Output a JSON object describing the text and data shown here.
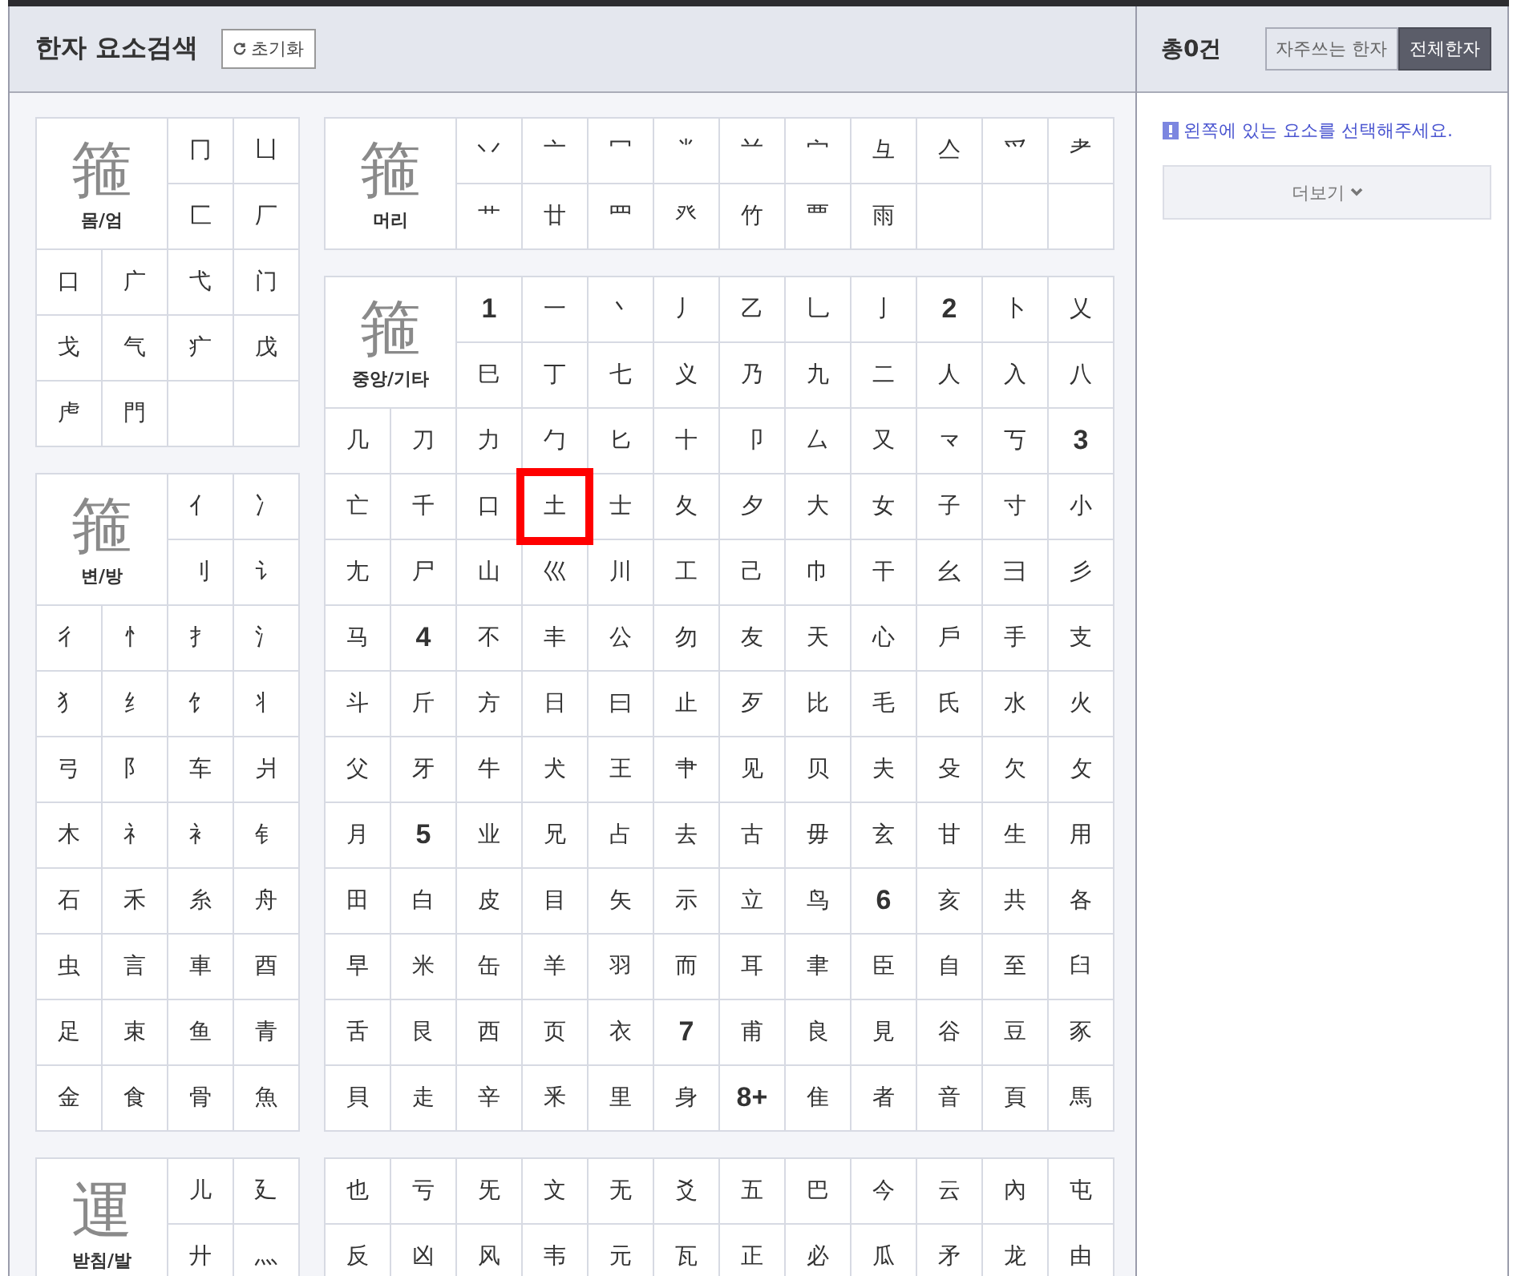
{
  "header": {
    "title": "한자 요소검색",
    "reset_button": "초기화"
  },
  "left_panels": [
    {
      "example": "箍",
      "label": "몸/엄",
      "cells": [
        {
          "text": "冂",
          "kind": "radical",
          "selected": false
        },
        {
          "text": "凵",
          "kind": "radical",
          "selected": false
        },
        {
          "text": "匚",
          "kind": "radical",
          "selected": false
        },
        {
          "text": "厂",
          "kind": "radical",
          "selected": false
        },
        {
          "text": "口",
          "kind": "radical",
          "selected": false
        },
        {
          "text": "广",
          "kind": "radical",
          "selected": false
        },
        {
          "text": "弋",
          "kind": "radical",
          "selected": false
        },
        {
          "text": "门",
          "kind": "radical",
          "selected": false
        },
        {
          "text": "戈",
          "kind": "radical",
          "selected": false
        },
        {
          "text": "气",
          "kind": "radical",
          "selected": false
        },
        {
          "text": "疒",
          "kind": "radical",
          "selected": false
        },
        {
          "text": "戊",
          "kind": "radical",
          "selected": false
        },
        {
          "text": "虍",
          "kind": "radical",
          "selected": false
        },
        {
          "text": "門",
          "kind": "radical",
          "selected": false
        }
      ]
    },
    {
      "example": "箍",
      "label": "변/방",
      "cells": [
        {
          "text": "亻",
          "kind": "radical",
          "selected": false
        },
        {
          "text": "冫",
          "kind": "radical",
          "selected": false
        },
        {
          "text": "刂",
          "kind": "radical",
          "selected": false
        },
        {
          "text": "讠",
          "kind": "radical",
          "selected": false
        },
        {
          "text": "彳",
          "kind": "radical",
          "selected": false
        },
        {
          "text": "忄",
          "kind": "radical",
          "selected": false
        },
        {
          "text": "扌",
          "kind": "radical",
          "selected": false
        },
        {
          "text": "氵",
          "kind": "radical",
          "selected": false
        },
        {
          "text": "犭",
          "kind": "radical",
          "selected": false
        },
        {
          "text": "纟",
          "kind": "radical",
          "selected": false
        },
        {
          "text": "饣",
          "kind": "radical",
          "selected": false
        },
        {
          "text": "丬",
          "kind": "radical",
          "selected": false
        },
        {
          "text": "弓",
          "kind": "radical",
          "selected": false
        },
        {
          "text": "阝",
          "kind": "radical",
          "selected": false
        },
        {
          "text": "车",
          "kind": "radical",
          "selected": false
        },
        {
          "text": "爿",
          "kind": "radical",
          "selected": false
        },
        {
          "text": "木",
          "kind": "radical",
          "selected": false
        },
        {
          "text": "礻",
          "kind": "radical",
          "selected": false
        },
        {
          "text": "衤",
          "kind": "radical",
          "selected": false
        },
        {
          "text": "钅",
          "kind": "radical",
          "selected": false
        },
        {
          "text": "石",
          "kind": "radical",
          "selected": false
        },
        {
          "text": "禾",
          "kind": "radical",
          "selected": false
        },
        {
          "text": "糸",
          "kind": "radical",
          "selected": false
        },
        {
          "text": "舟",
          "kind": "radical",
          "selected": false
        },
        {
          "text": "虫",
          "kind": "radical",
          "selected": false
        },
        {
          "text": "言",
          "kind": "radical",
          "selected": false
        },
        {
          "text": "車",
          "kind": "radical",
          "selected": false
        },
        {
          "text": "酉",
          "kind": "radical",
          "selected": false
        },
        {
          "text": "足",
          "kind": "radical",
          "selected": false
        },
        {
          "text": "束",
          "kind": "radical",
          "selected": false
        },
        {
          "text": "鱼",
          "kind": "radical",
          "selected": false
        },
        {
          "text": "青",
          "kind": "radical",
          "selected": false
        },
        {
          "text": "金",
          "kind": "radical",
          "selected": false
        },
        {
          "text": "食",
          "kind": "radical",
          "selected": false
        },
        {
          "text": "骨",
          "kind": "radical",
          "selected": false
        },
        {
          "text": "魚",
          "kind": "radical",
          "selected": false
        }
      ]
    },
    {
      "example": "運",
      "label": "받침/발",
      "cells": [
        {
          "text": "儿",
          "kind": "radical",
          "selected": false
        },
        {
          "text": "廴",
          "kind": "radical",
          "selected": false
        },
        {
          "text": "廾",
          "kind": "radical",
          "selected": false
        },
        {
          "text": "灬",
          "kind": "radical",
          "selected": false
        }
      ]
    }
  ],
  "center_panels": [
    {
      "example": "箍",
      "label": "머리",
      "cells": [
        {
          "text": "丷",
          "kind": "radical",
          "selected": false
        },
        {
          "text": "亠",
          "kind": "radical",
          "selected": false
        },
        {
          "text": "冖",
          "kind": "radical",
          "selected": false
        },
        {
          "text": "⺌",
          "kind": "radical",
          "selected": false
        },
        {
          "text": "䒑",
          "kind": "radical",
          "selected": false
        },
        {
          "text": "宀",
          "kind": "radical",
          "selected": false
        },
        {
          "text": "彑",
          "kind": "radical",
          "selected": false
        },
        {
          "text": "亼",
          "kind": "radical",
          "selected": false
        },
        {
          "text": "爫",
          "kind": "radical",
          "selected": false
        },
        {
          "text": "耂",
          "kind": "radical",
          "selected": false
        },
        {
          "text": "艹",
          "kind": "radical",
          "selected": false
        },
        {
          "text": "廿",
          "kind": "radical",
          "selected": false
        },
        {
          "text": "罒",
          "kind": "radical",
          "selected": false
        },
        {
          "text": "癶",
          "kind": "radical",
          "selected": false
        },
        {
          "text": "竹",
          "kind": "radical",
          "selected": false
        },
        {
          "text": "覀",
          "kind": "radical",
          "selected": false
        },
        {
          "text": "雨",
          "kind": "radical",
          "selected": false
        }
      ]
    },
    {
      "example": "箍",
      "label": "중앙/기타",
      "cells": [
        {
          "text": "1",
          "kind": "count",
          "selected": false
        },
        {
          "text": "一",
          "kind": "radical",
          "selected": false
        },
        {
          "text": "丶",
          "kind": "radical",
          "selected": false
        },
        {
          "text": "丿",
          "kind": "radical",
          "selected": false
        },
        {
          "text": "乙",
          "kind": "radical",
          "selected": false
        },
        {
          "text": "乚",
          "kind": "radical",
          "selected": false
        },
        {
          "text": "亅",
          "kind": "radical",
          "selected": false
        },
        {
          "text": "2",
          "kind": "count",
          "selected": false
        },
        {
          "text": "卜",
          "kind": "radical",
          "selected": false
        },
        {
          "text": "乂",
          "kind": "radical",
          "selected": false
        },
        {
          "text": "巳",
          "kind": "radical",
          "selected": false
        },
        {
          "text": "丁",
          "kind": "radical",
          "selected": false
        },
        {
          "text": "七",
          "kind": "radical",
          "selected": false
        },
        {
          "text": "义",
          "kind": "radical",
          "selected": false
        },
        {
          "text": "乃",
          "kind": "radical",
          "selected": false
        },
        {
          "text": "九",
          "kind": "radical",
          "selected": false
        },
        {
          "text": "二",
          "kind": "radical",
          "selected": false
        },
        {
          "text": "人",
          "kind": "radical",
          "selected": false
        },
        {
          "text": "入",
          "kind": "radical",
          "selected": false
        },
        {
          "text": "八",
          "kind": "radical",
          "selected": false
        },
        {
          "text": "几",
          "kind": "radical",
          "selected": false
        },
        {
          "text": "刀",
          "kind": "radical",
          "selected": false
        },
        {
          "text": "力",
          "kind": "radical",
          "selected": false
        },
        {
          "text": "勹",
          "kind": "radical",
          "selected": false
        },
        {
          "text": "匕",
          "kind": "radical",
          "selected": false
        },
        {
          "text": "十",
          "kind": "radical",
          "selected": false
        },
        {
          "text": "卩",
          "kind": "radical",
          "selected": false
        },
        {
          "text": "厶",
          "kind": "radical",
          "selected": false
        },
        {
          "text": "又",
          "kind": "radical",
          "selected": false
        },
        {
          "text": "龴",
          "kind": "radical",
          "selected": false
        },
        {
          "text": "丂",
          "kind": "radical",
          "selected": false
        },
        {
          "text": "3",
          "kind": "count",
          "selected": false
        },
        {
          "text": "亡",
          "kind": "radical",
          "selected": false
        },
        {
          "text": "千",
          "kind": "radical",
          "selected": false
        },
        {
          "text": "口",
          "kind": "radical",
          "selected": false
        },
        {
          "text": "土",
          "kind": "radical",
          "selected": true
        },
        {
          "text": "士",
          "kind": "radical",
          "selected": false
        },
        {
          "text": "夂",
          "kind": "radical",
          "selected": false
        },
        {
          "text": "夕",
          "kind": "radical",
          "selected": false
        },
        {
          "text": "大",
          "kind": "radical",
          "selected": false
        },
        {
          "text": "女",
          "kind": "radical",
          "selected": false
        },
        {
          "text": "子",
          "kind": "radical",
          "selected": false
        },
        {
          "text": "寸",
          "kind": "radical",
          "selected": false
        },
        {
          "text": "小",
          "kind": "radical",
          "selected": false
        },
        {
          "text": "尢",
          "kind": "radical",
          "selected": false
        },
        {
          "text": "尸",
          "kind": "radical",
          "selected": false
        },
        {
          "text": "山",
          "kind": "radical",
          "selected": false
        },
        {
          "text": "巛",
          "kind": "radical",
          "selected": false
        },
        {
          "text": "川",
          "kind": "radical",
          "selected": false
        },
        {
          "text": "工",
          "kind": "radical",
          "selected": false
        },
        {
          "text": "己",
          "kind": "radical",
          "selected": false
        },
        {
          "text": "巾",
          "kind": "radical",
          "selected": false
        },
        {
          "text": "干",
          "kind": "radical",
          "selected": false
        },
        {
          "text": "幺",
          "kind": "radical",
          "selected": false
        },
        {
          "text": "彐",
          "kind": "radical",
          "selected": false
        },
        {
          "text": "彡",
          "kind": "radical",
          "selected": false
        },
        {
          "text": "马",
          "kind": "radical",
          "selected": false
        },
        {
          "text": "4",
          "kind": "count",
          "selected": false
        },
        {
          "text": "不",
          "kind": "radical",
          "selected": false
        },
        {
          "text": "丰",
          "kind": "radical",
          "selected": false
        },
        {
          "text": "公",
          "kind": "radical",
          "selected": false
        },
        {
          "text": "勿",
          "kind": "radical",
          "selected": false
        },
        {
          "text": "友",
          "kind": "radical",
          "selected": false
        },
        {
          "text": "天",
          "kind": "radical",
          "selected": false
        },
        {
          "text": "心",
          "kind": "radical",
          "selected": false
        },
        {
          "text": "戶",
          "kind": "radical",
          "selected": false
        },
        {
          "text": "手",
          "kind": "radical",
          "selected": false
        },
        {
          "text": "支",
          "kind": "radical",
          "selected": false
        },
        {
          "text": "斗",
          "kind": "radical",
          "selected": false
        },
        {
          "text": "斤",
          "kind": "radical",
          "selected": false
        },
        {
          "text": "方",
          "kind": "radical",
          "selected": false
        },
        {
          "text": "日",
          "kind": "radical",
          "selected": false
        },
        {
          "text": "曰",
          "kind": "radical",
          "selected": false
        },
        {
          "text": "止",
          "kind": "radical",
          "selected": false
        },
        {
          "text": "歹",
          "kind": "radical",
          "selected": false
        },
        {
          "text": "比",
          "kind": "radical",
          "selected": false
        },
        {
          "text": "毛",
          "kind": "radical",
          "selected": false
        },
        {
          "text": "氏",
          "kind": "radical",
          "selected": false
        },
        {
          "text": "水",
          "kind": "radical",
          "selected": false
        },
        {
          "text": "火",
          "kind": "radical",
          "selected": false
        },
        {
          "text": "父",
          "kind": "radical",
          "selected": false
        },
        {
          "text": "牙",
          "kind": "radical",
          "selected": false
        },
        {
          "text": "牛",
          "kind": "radical",
          "selected": false
        },
        {
          "text": "犬",
          "kind": "radical",
          "selected": false
        },
        {
          "text": "王",
          "kind": "radical",
          "selected": false
        },
        {
          "text": "肀",
          "kind": "radical",
          "selected": false
        },
        {
          "text": "见",
          "kind": "radical",
          "selected": false
        },
        {
          "text": "贝",
          "kind": "radical",
          "selected": false
        },
        {
          "text": "夫",
          "kind": "radical",
          "selected": false
        },
        {
          "text": "殳",
          "kind": "radical",
          "selected": false
        },
        {
          "text": "欠",
          "kind": "radical",
          "selected": false
        },
        {
          "text": "攵",
          "kind": "radical",
          "selected": false
        },
        {
          "text": "月",
          "kind": "radical",
          "selected": false
        },
        {
          "text": "5",
          "kind": "count",
          "selected": false
        },
        {
          "text": "业",
          "kind": "radical",
          "selected": false
        },
        {
          "text": "兄",
          "kind": "radical",
          "selected": false
        },
        {
          "text": "占",
          "kind": "radical",
          "selected": false
        },
        {
          "text": "去",
          "kind": "radical",
          "selected": false
        },
        {
          "text": "古",
          "kind": "radical",
          "selected": false
        },
        {
          "text": "毋",
          "kind": "radical",
          "selected": false
        },
        {
          "text": "玄",
          "kind": "radical",
          "selected": false
        },
        {
          "text": "甘",
          "kind": "radical",
          "selected": false
        },
        {
          "text": "生",
          "kind": "radical",
          "selected": false
        },
        {
          "text": "用",
          "kind": "radical",
          "selected": false
        },
        {
          "text": "田",
          "kind": "radical",
          "selected": false
        },
        {
          "text": "白",
          "kind": "radical",
          "selected": false
        },
        {
          "text": "皮",
          "kind": "radical",
          "selected": false
        },
        {
          "text": "目",
          "kind": "radical",
          "selected": false
        },
        {
          "text": "矢",
          "kind": "radical",
          "selected": false
        },
        {
          "text": "示",
          "kind": "radical",
          "selected": false
        },
        {
          "text": "立",
          "kind": "radical",
          "selected": false
        },
        {
          "text": "鸟",
          "kind": "radical",
          "selected": false
        },
        {
          "text": "6",
          "kind": "count",
          "selected": false
        },
        {
          "text": "亥",
          "kind": "radical",
          "selected": false
        },
        {
          "text": "共",
          "kind": "radical",
          "selected": false
        },
        {
          "text": "各",
          "kind": "radical",
          "selected": false
        },
        {
          "text": "早",
          "kind": "radical",
          "selected": false
        },
        {
          "text": "米",
          "kind": "radical",
          "selected": false
        },
        {
          "text": "缶",
          "kind": "radical",
          "selected": false
        },
        {
          "text": "羊",
          "kind": "radical",
          "selected": false
        },
        {
          "text": "羽",
          "kind": "radical",
          "selected": false
        },
        {
          "text": "而",
          "kind": "radical",
          "selected": false
        },
        {
          "text": "耳",
          "kind": "radical",
          "selected": false
        },
        {
          "text": "聿",
          "kind": "radical",
          "selected": false
        },
        {
          "text": "臣",
          "kind": "radical",
          "selected": false
        },
        {
          "text": "自",
          "kind": "radical",
          "selected": false
        },
        {
          "text": "至",
          "kind": "radical",
          "selected": false
        },
        {
          "text": "臼",
          "kind": "radical",
          "selected": false
        },
        {
          "text": "舌",
          "kind": "radical",
          "selected": false
        },
        {
          "text": "艮",
          "kind": "radical",
          "selected": false
        },
        {
          "text": "西",
          "kind": "radical",
          "selected": false
        },
        {
          "text": "页",
          "kind": "radical",
          "selected": false
        },
        {
          "text": "衣",
          "kind": "radical",
          "selected": false
        },
        {
          "text": "7",
          "kind": "count",
          "selected": false
        },
        {
          "text": "甫",
          "kind": "radical",
          "selected": false
        },
        {
          "text": "良",
          "kind": "radical",
          "selected": false
        },
        {
          "text": "見",
          "kind": "radical",
          "selected": false
        },
        {
          "text": "谷",
          "kind": "radical",
          "selected": false
        },
        {
          "text": "豆",
          "kind": "radical",
          "selected": false
        },
        {
          "text": "豕",
          "kind": "radical",
          "selected": false
        },
        {
          "text": "貝",
          "kind": "radical",
          "selected": false
        },
        {
          "text": "走",
          "kind": "radical",
          "selected": false
        },
        {
          "text": "辛",
          "kind": "radical",
          "selected": false
        },
        {
          "text": "釆",
          "kind": "radical",
          "selected": false
        },
        {
          "text": "里",
          "kind": "radical",
          "selected": false
        },
        {
          "text": "身",
          "kind": "radical",
          "selected": false
        },
        {
          "text": "8+",
          "kind": "count",
          "selected": false
        },
        {
          "text": "隹",
          "kind": "radical",
          "selected": false
        },
        {
          "text": "者",
          "kind": "radical",
          "selected": false
        },
        {
          "text": "音",
          "kind": "radical",
          "selected": false
        },
        {
          "text": "頁",
          "kind": "radical",
          "selected": false
        },
        {
          "text": "馬",
          "kind": "radical",
          "selected": false
        }
      ]
    },
    {
      "cells": [
        {
          "text": "也",
          "kind": "radical",
          "selected": false
        },
        {
          "text": "亏",
          "kind": "radical",
          "selected": false
        },
        {
          "text": "旡",
          "kind": "radical",
          "selected": false
        },
        {
          "text": "文",
          "kind": "radical",
          "selected": false
        },
        {
          "text": "无",
          "kind": "radical",
          "selected": false
        },
        {
          "text": "爻",
          "kind": "radical",
          "selected": false
        },
        {
          "text": "五",
          "kind": "radical",
          "selected": false
        },
        {
          "text": "巴",
          "kind": "radical",
          "selected": false
        },
        {
          "text": "今",
          "kind": "radical",
          "selected": false
        },
        {
          "text": "云",
          "kind": "radical",
          "selected": false
        },
        {
          "text": "內",
          "kind": "radical",
          "selected": false
        },
        {
          "text": "屯",
          "kind": "radical",
          "selected": false
        },
        {
          "text": "反",
          "kind": "radical",
          "selected": false
        },
        {
          "text": "凶",
          "kind": "radical",
          "selected": false
        },
        {
          "text": "风",
          "kind": "radical",
          "selected": false
        },
        {
          "text": "韦",
          "kind": "radical",
          "selected": false
        },
        {
          "text": "元",
          "kind": "radical",
          "selected": false
        },
        {
          "text": "瓦",
          "kind": "radical",
          "selected": false
        },
        {
          "text": "正",
          "kind": "radical",
          "selected": false
        },
        {
          "text": "必",
          "kind": "radical",
          "selected": false
        },
        {
          "text": "瓜",
          "kind": "radical",
          "selected": false
        },
        {
          "text": "矛",
          "kind": "radical",
          "selected": false
        },
        {
          "text": "龙",
          "kind": "radical",
          "selected": false
        },
        {
          "text": "由",
          "kind": "radical",
          "selected": false
        }
      ]
    }
  ],
  "result": {
    "count": "총0건",
    "tabs": [
      {
        "label": "자주쓰는 한자",
        "selected": false
      },
      {
        "label": "전체한자",
        "selected": true
      }
    ],
    "notice": "왼쪽에 있는 요소를 선택해주세요.",
    "more_button": "더보기"
  }
}
